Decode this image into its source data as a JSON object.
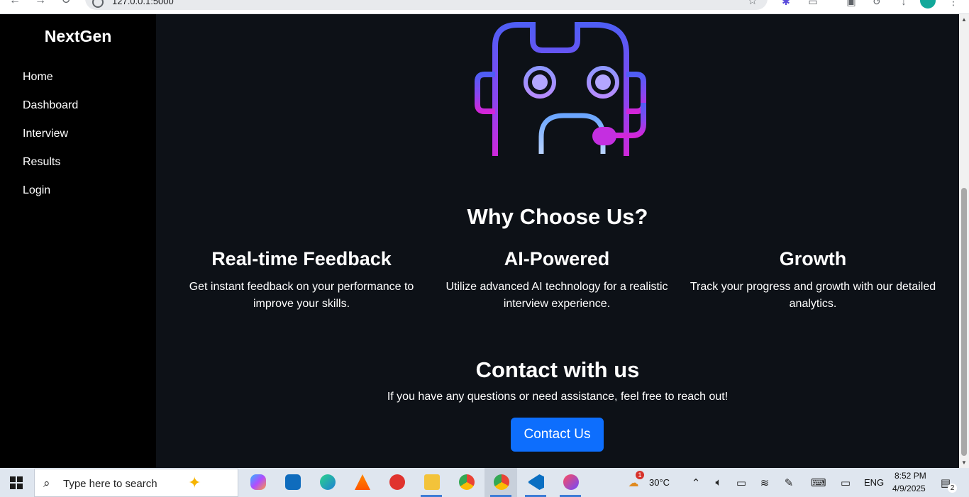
{
  "browser": {
    "url": "127.0.0.1:5000",
    "back_icon": "back-arrow-icon",
    "forward_icon": "forward-arrow-icon",
    "reload_icon": "reload-icon",
    "bookmark_icon": "star-icon"
  },
  "sidebar": {
    "brand": "NextGen",
    "items": [
      {
        "label": "Home"
      },
      {
        "label": "Dashboard"
      },
      {
        "label": "Interview"
      },
      {
        "label": "Results"
      },
      {
        "label": "Login"
      }
    ]
  },
  "hero": {
    "image_icon": "robot-headset-icon"
  },
  "why": {
    "title": "Why Choose Us?",
    "features": [
      {
        "title": "Real-time Feedback",
        "text": "Get instant feedback on your performance to improve your skills."
      },
      {
        "title": "AI-Powered",
        "text": "Utilize advanced AI technology for a realistic interview experience."
      },
      {
        "title": "Growth",
        "text": "Track your progress and growth with our detailed analytics."
      }
    ]
  },
  "contact": {
    "title": "Contact with us",
    "text": "If you have any questions or need assistance, feel free to reach out!",
    "button": "Contact Us"
  },
  "colors": {
    "background": "#0d1117",
    "sidebar": "#000000",
    "button": "#0d6efd"
  },
  "taskbar": {
    "search_placeholder": "Type here to search",
    "weather": "30°C",
    "weather_badge": "1",
    "language": "ENG",
    "time": "8:52 PM",
    "date": "4/9/2025",
    "notifications": "2",
    "apps": [
      "copilot-icon",
      "outlook-icon",
      "edge-icon",
      "vlc-icon",
      "app-icon",
      "file-explorer-icon",
      "chrome-icon",
      "chrome-profile-icon",
      "vscode-icon",
      "snipping-tool-icon"
    ]
  }
}
